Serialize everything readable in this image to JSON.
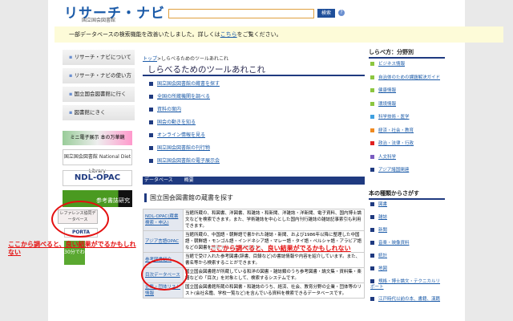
{
  "header": {
    "logo": "リサーチ・ナビ",
    "logo_sub": "国立国会図書館",
    "search_value": "",
    "search_button": "検索",
    "help": "?"
  },
  "notice": {
    "text": "一部データベースの検索機能を改善いたしました。詳しくは",
    "link": "こちら",
    "after": "をご覧ください。"
  },
  "left_nav": [
    "リサーチ・ナビについて",
    "リサーチ・ナビの使い方",
    "国立国会図書館に行く",
    "図書館にきく"
  ],
  "banners": [
    "ミニ電子展示 本の万華鏡",
    "国立国会図書館 National Diet Library",
    "NDL-OPAC",
    "参考書誌研究",
    "レファレンス協同データベース",
    "PORTA",
    "30分でわかる"
  ],
  "breadcrumb": {
    "top": "トップ",
    "current": "しらべるためのツールあれこれ"
  },
  "page_title": "しらべるためのツールあれこれ",
  "links": [
    "国立国会図書館の蔵書を探す",
    "全国の所蔵機関を調べる",
    "資料の案内",
    "国会の動きを知る",
    "オンライン情報を見る",
    "国立国会図書館の刊行物",
    "国立国会図書館の電子展示会"
  ],
  "db_header": {
    "col1": "データベース",
    "col2": "概要"
  },
  "section_title": "国立国会図書館の蔵書を探す",
  "rows": [
    {
      "name": "NDL-OPAC(蔵書検索・申込)",
      "desc": "当館所蔵の、和図書、洋図書、和雑誌・和新聞、洋雑誌・洋新聞、電子資料、国内博士論文などを検索できます。また、学術雑誌を中心とした国内刊行雑誌の雑誌記事索引も利用できます。"
    },
    {
      "name": "アジア言語OPAC",
      "desc": "当館所蔵の、中国語・朝鮮語で書かれた雑誌・新聞、および1986年以降に整理した中国語・朝鮮語・モンゴル語・インドネシア語・マレー語・タイ語・ペルシャ語・アラビア語などの図書を検索することができます。"
    },
    {
      "name": "参考図書紹介",
      "desc": "当館で受け入れた参考図書(辞書、目録など)の書誌情報や内容を紹介しています。また、書名等から検索することができます。"
    },
    {
      "name": "目次データベース",
      "desc": "国立国会図書館が所蔵している和洋の図書・雑誌類のうち参考図書・論文集・資料集・楽譜などの「目次」を対象として、検索するシステムです。"
    },
    {
      "name": "企業・団体リスト情報",
      "desc": "国立国会図書館所蔵の和図書・和雑誌のうち、経済、社会、教育分野の企業・団体等のリスト(会社名鑑、学校一覧など)を含んでいる資料を検索できるデータベースです。"
    }
  ],
  "right": {
    "heading1": "しらべ方：分野別",
    "fields": [
      {
        "label": "ビジネス情報",
        "color": "#8cc63f"
      },
      {
        "label": "自治体のための課題解決ガイド",
        "color": "#8cc63f"
      },
      {
        "label": "健康情報",
        "color": "#8cc63f"
      },
      {
        "label": "環境情報",
        "color": "#8cc63f"
      },
      {
        "label": "科学技術・医学",
        "color": "#3fa0e0"
      },
      {
        "label": "経済・社会・教育",
        "color": "#f08a20"
      },
      {
        "label": "政治・法律・行政",
        "color": "#e02020"
      },
      {
        "label": "人文科学",
        "color": "#7a5cc0"
      },
      {
        "label": "アジア諸国関連",
        "color": "#1f3a80"
      }
    ],
    "heading2": "本の種類からさがす",
    "types": [
      "図書",
      "雑誌",
      "新聞",
      "音楽・映像資料",
      "統計",
      "地図",
      "規格・博士論文・テクニカルリポート",
      "江戸時代以前の本、書籍、漢籍"
    ]
  },
  "annotation": "ここから調べると、良い結果がでるかもしれない"
}
